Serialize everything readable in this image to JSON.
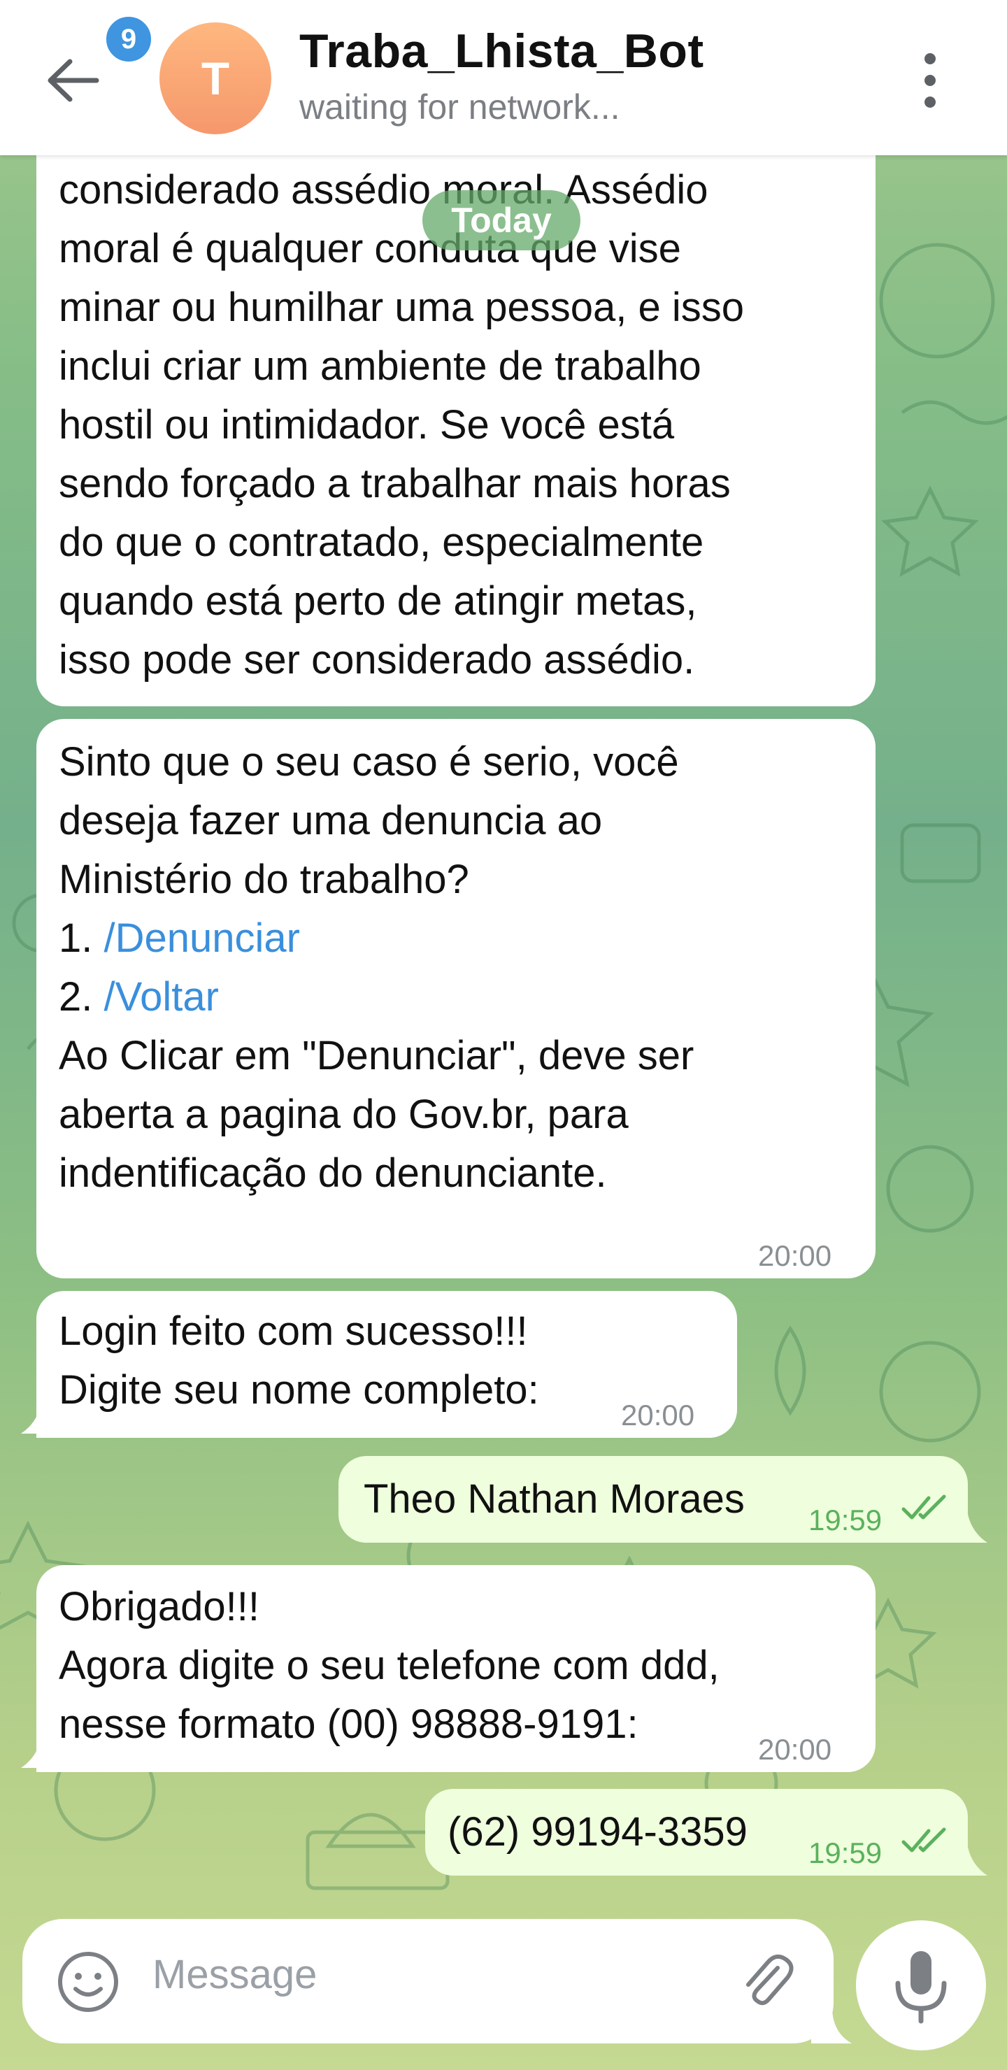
{
  "header": {
    "back_icon": "arrow-left-icon",
    "badge_count": "9",
    "avatar_letter": "T",
    "title": "Traba_Lhista_Bot",
    "status": "waiting for network...",
    "menu_icon": "more-vert-icon"
  },
  "date_separator": "Today",
  "messages": [
    {
      "direction": "in",
      "lines": [
        "considerado assédio moral. Assédio",
        "moral é qualquer conduta que vise",
        "minar ou humilhar uma pessoa, e isso",
        "inclui criar um ambiente de trabalho",
        "hostil ou intimidador. Se você está",
        "sendo forçado a trabalhar mais horas",
        "do que o contratado, especialmente",
        "quando está perto de atingir metas,",
        "isso pode ser considerado assédio."
      ]
    },
    {
      "direction": "in",
      "lines": [
        "Sinto que o seu caso é serio, você",
        "deseja fazer uma denuncia ao",
        "Ministério do trabalho?"
      ],
      "options": [
        {
          "num": "1. ",
          "command": "/Denunciar"
        },
        {
          "num": "2. ",
          "command": "/Voltar"
        }
      ],
      "lines_after": [
        "Ao Clicar em \"Denunciar\", deve ser",
        "aberta a pagina do Gov.br, para",
        "indentificação do denunciante."
      ],
      "time": "20:00"
    },
    {
      "direction": "in",
      "lines": [
        "Login feito com sucesso!!!",
        "Digite seu nome completo:"
      ],
      "time": "20:00"
    },
    {
      "direction": "out",
      "lines": [
        "Theo Nathan Moraes"
      ],
      "time": "19:59",
      "status_icon": "double-check-icon"
    },
    {
      "direction": "in",
      "lines": [
        "Obrigado!!!",
        "Agora digite o seu telefone com ddd,",
        "nesse formato (00) 98888-9191:"
      ],
      "time": "20:00"
    },
    {
      "direction": "out",
      "lines": [
        "(62) 99194-3359"
      ],
      "time": "19:59",
      "status_icon": "double-check-icon"
    }
  ],
  "composer": {
    "placeholder": "Message",
    "emoji_icon": "emoji-icon",
    "attach_icon": "paperclip-icon",
    "mic_icon": "microphone-icon"
  },
  "colors": {
    "incoming_bubble": "#ffffff",
    "outgoing_bubble": "#effedd",
    "command_link": "#3a8fdc",
    "outgoing_time": "#5bb15d",
    "badge": "#3f95df"
  }
}
